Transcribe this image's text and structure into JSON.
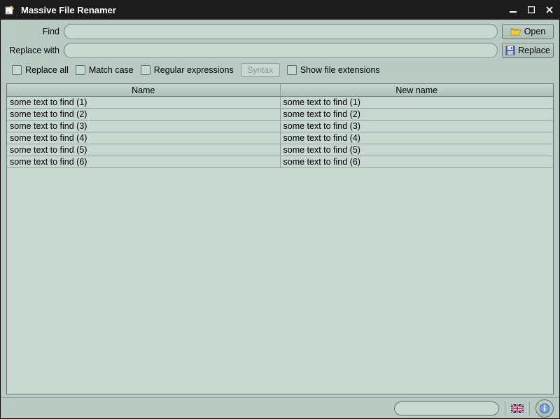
{
  "titlebar": {
    "title": "Massive File Renamer"
  },
  "form": {
    "find_label": "Find",
    "find_value": "",
    "replace_label": "Replace with",
    "replace_value": "",
    "open_btn": "Open",
    "replace_btn": "Replace"
  },
  "options": {
    "replace_all": "Replace all",
    "match_case": "Match case",
    "regex": "Regular expressions",
    "syntax_btn": "Syntax",
    "show_ext": "Show file extensions"
  },
  "table": {
    "headers": {
      "name": "Name",
      "newname": "New name"
    },
    "rows": [
      {
        "name": "some text to find (1)",
        "newname": "some text to find (1)"
      },
      {
        "name": "some text to find (2)",
        "newname": "some text to find (2)"
      },
      {
        "name": "some text to find (3)",
        "newname": "some text to find (3)"
      },
      {
        "name": "some text to find (4)",
        "newname": "some text to find (4)"
      },
      {
        "name": "some text to find (5)",
        "newname": "some text to find (5)"
      },
      {
        "name": "some text to find (6)",
        "newname": "some text to find (6)"
      }
    ]
  },
  "statusbar": {
    "flag": "uk-flag",
    "info": "info"
  }
}
